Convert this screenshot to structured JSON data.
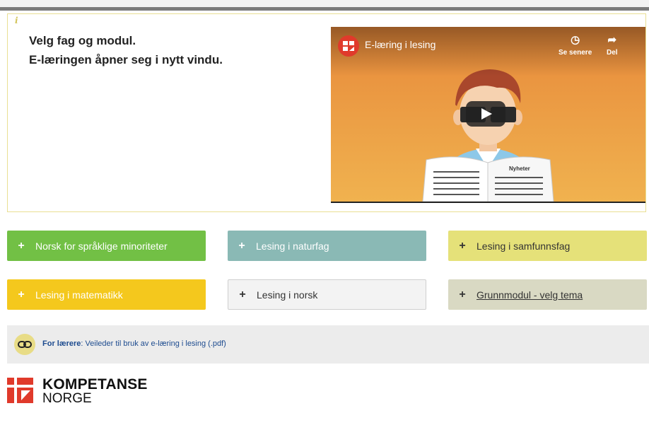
{
  "info": {
    "line1": "Velg fag og modul.",
    "line2": "E-læringen åpner seg i nytt vindu."
  },
  "video": {
    "title": "E-læring i lesing",
    "watch_later_label": "Se senere",
    "share_label": "Del",
    "newspaper_text": "Nyheter"
  },
  "modules": [
    {
      "label": "Norsk for språklige minoriteter",
      "icon": "+"
    },
    {
      "label": "Lesing i naturfag",
      "icon": "+"
    },
    {
      "label": "Lesing i samfunnsfag",
      "icon": "+"
    },
    {
      "label": "Lesing i matematikk",
      "icon": "+"
    },
    {
      "label": "Lesing i norsk",
      "icon": "+"
    },
    {
      "label": "Grunnmodul - velg tema",
      "icon": "+"
    }
  ],
  "teacher": {
    "prefix": "For lærere",
    "link_text": ": Veileder til bruk av e-læring i lesing (.pdf)"
  },
  "logo": {
    "line1": "KOMPETANSE",
    "line2": "NORGE"
  },
  "colors": {
    "green": "#72c045",
    "teal": "#8ab9b5",
    "yellow": "#e5e179",
    "gold": "#f4c81d",
    "khaki": "#d9d9c3",
    "brand_red": "#e03a2b"
  }
}
